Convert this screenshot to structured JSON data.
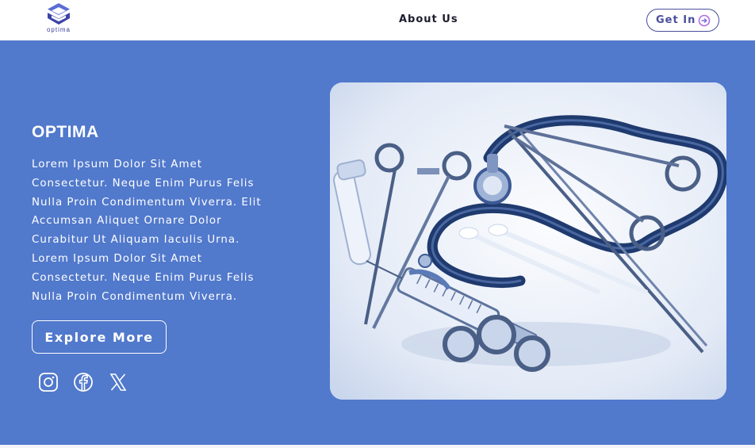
{
  "header": {
    "logo_text": "optima",
    "nav_about": "About Us",
    "cta_label": "Get In"
  },
  "hero": {
    "title": "OPTIMA",
    "body": "Lorem Ipsum Dolor Sit Amet Consectetur. Neque Enim Purus Felis Nulla Proin Condimentum Viverra. Elit Accumsan Aliquet Ornare Dolor Curabitur Ut Aliquam Iaculis Urna. Lorem Ipsum Dolor Sit Amet Consectetur. Neque Enim Purus Felis Nulla Proin Condimentum Viverra.",
    "explore_label": "Explore More",
    "socials": [
      "instagram-icon",
      "facebook-icon",
      "x-icon"
    ]
  },
  "colors": {
    "hero_bg": "#5179cc",
    "brand": "#4a4f9c",
    "white": "#ffffff"
  }
}
